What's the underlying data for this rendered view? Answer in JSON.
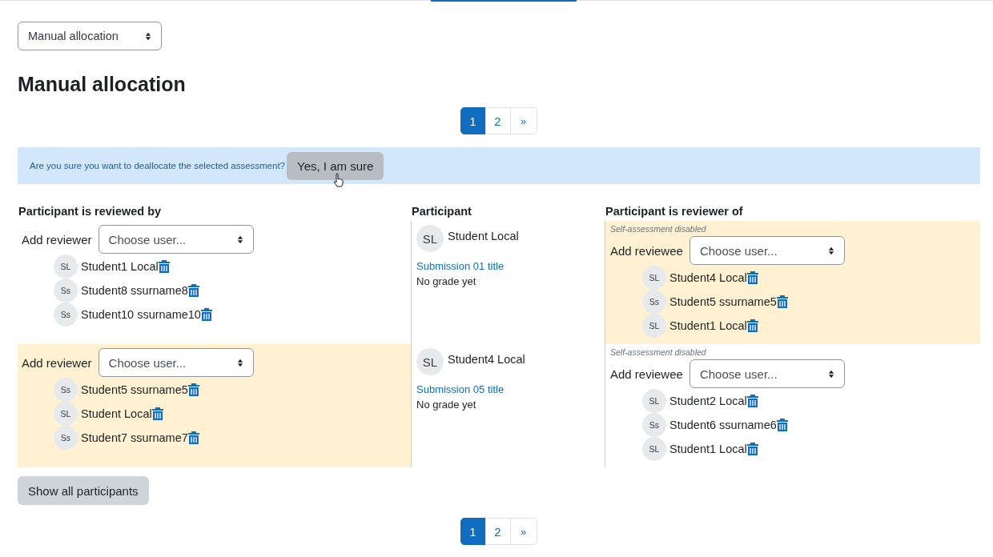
{
  "allocation_select": {
    "value": "Manual allocation"
  },
  "heading": "Manual allocation",
  "pagination_top": [
    {
      "label": "1",
      "selected": true
    },
    {
      "label": "2",
      "selected": false
    },
    {
      "label": "»",
      "selected": false
    }
  ],
  "confirm": {
    "message": "Are you sure you want to deallocate the selected assessment?",
    "button": "Yes, I am sure"
  },
  "table": {
    "columns": [
      "Participant is reviewed by",
      "Participant",
      "Participant is reviewer of"
    ],
    "rows": [
      {
        "reviewed_by": {
          "highlighted": false,
          "add_label": "Add reviewer",
          "select_value": "Choose user...",
          "users": [
            {
              "initials": "SL",
              "name": "Student1 Local"
            },
            {
              "initials": "Ss",
              "name": "Student8 ssurname8"
            },
            {
              "initials": "Ss",
              "name": "Student10 ssurname10"
            }
          ]
        },
        "participant": {
          "initials": "SL",
          "name": "Student Local",
          "submission": "Submission 01 title",
          "grade": "No grade yet"
        },
        "reviewer_of": {
          "highlighted": true,
          "note": "Self-assessment disabled",
          "add_label": "Add reviewee",
          "select_value": "Choose user...",
          "users": [
            {
              "initials": "SL",
              "name": "Student4 Local"
            },
            {
              "initials": "Ss",
              "name": "Student5 ssurname5"
            },
            {
              "initials": "SL",
              "name": "Student1 Local"
            }
          ]
        }
      },
      {
        "reviewed_by": {
          "highlighted": true,
          "add_label": "Add reviewer",
          "select_value": "Choose user...",
          "users": [
            {
              "initials": "Ss",
              "name": "Student5 ssurname5"
            },
            {
              "initials": "SL",
              "name": "Student Local"
            },
            {
              "initials": "Ss",
              "name": "Student7 ssurname7"
            }
          ]
        },
        "participant": {
          "initials": "SL",
          "name": "Student4 Local",
          "submission": "Submission 05 title",
          "grade": "No grade yet"
        },
        "reviewer_of": {
          "highlighted": false,
          "note": "Self-assessment disabled",
          "add_label": "Add reviewee",
          "select_value": "Choose user...",
          "users": [
            {
              "initials": "SL",
              "name": "Student2 Local"
            },
            {
              "initials": "Ss",
              "name": "Student6 ssurname6"
            },
            {
              "initials": "SL",
              "name": "Student1 Local"
            }
          ]
        }
      }
    ]
  },
  "show_all_button": "Show all participants",
  "pagination_bottom": [
    {
      "label": "1",
      "selected": true
    },
    {
      "label": "2",
      "selected": false
    },
    {
      "label": "»",
      "selected": false
    }
  ]
}
